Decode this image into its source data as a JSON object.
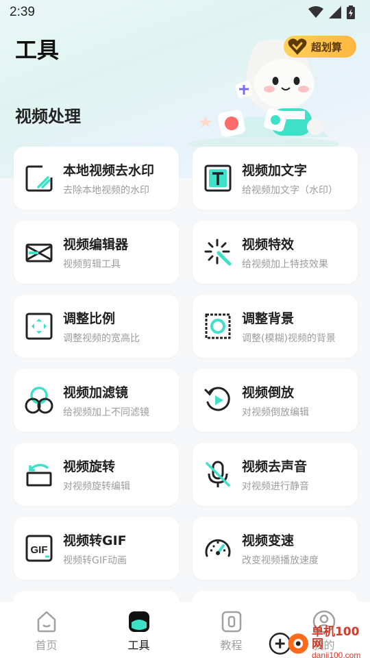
{
  "status_bar": {
    "time": "2:39",
    "icons": [
      "wifi-icon",
      "signal-icon",
      "battery-icon"
    ]
  },
  "header": {
    "title": "工具",
    "promo_label": "超划算"
  },
  "section": {
    "title": "视频处理"
  },
  "tools": [
    {
      "title": "本地视频去水印",
      "subtitle": "去除本地视频的水印",
      "icon": "watermark-remove-icon"
    },
    {
      "title": "视频加文字",
      "subtitle": "给视频加文字（水印）",
      "icon": "text-icon"
    },
    {
      "title": "视频编辑器",
      "subtitle": "视频剪辑工具",
      "icon": "scissors-icon"
    },
    {
      "title": "视频特效",
      "subtitle": "给视频加上特技效果",
      "icon": "magic-wand-icon"
    },
    {
      "title": "调整比例",
      "subtitle": "调整视频的宽高比",
      "icon": "aspect-ratio-icon"
    },
    {
      "title": "调整背景",
      "subtitle": "调整(模糊)视频的背景",
      "icon": "background-icon"
    },
    {
      "title": "视频加滤镜",
      "subtitle": "给视频加上不同滤镜",
      "icon": "filter-icon"
    },
    {
      "title": "视频倒放",
      "subtitle": "对视频倒放编辑",
      "icon": "reverse-play-icon"
    },
    {
      "title": "视频旋转",
      "subtitle": "对视频旋转编辑",
      "icon": "rotate-icon"
    },
    {
      "title": "视频去声音",
      "subtitle": "对视频进行静音",
      "icon": "mute-mic-icon"
    },
    {
      "title": "视频转GIF",
      "subtitle": "视频转GIF动画",
      "icon": "gif-icon"
    },
    {
      "title": "视频变速",
      "subtitle": "改变视频播放速度",
      "icon": "speedometer-icon"
    }
  ],
  "nav": [
    {
      "label": "首页",
      "icon": "home-icon",
      "active": false
    },
    {
      "label": "工具",
      "icon": "tools-icon",
      "active": true
    },
    {
      "label": "教程",
      "icon": "tutorial-icon",
      "active": false
    },
    {
      "label": "我的",
      "icon": "profile-icon",
      "active": false
    }
  ],
  "watermark": {
    "cn": "单机100网",
    "en": "danji100.com"
  },
  "colors": {
    "accent": "#3ee0c8",
    "text": "#1f1f1f",
    "subtext": "#9c9c9c",
    "promo": "#ffc247"
  }
}
